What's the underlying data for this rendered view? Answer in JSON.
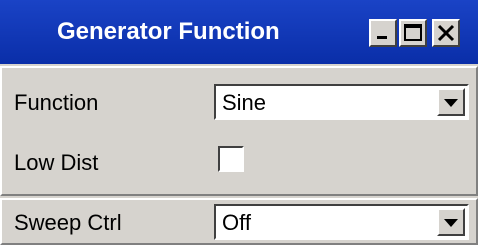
{
  "window": {
    "title": "Generator Function",
    "controls": [
      "minimize-icon",
      "maximize-icon",
      "close-icon"
    ]
  },
  "function_row": {
    "label": "Function",
    "value": "Sine"
  },
  "low_dist_row": {
    "label": "Low Dist",
    "checked": false
  },
  "sweep_row": {
    "label": "Sweep Ctrl",
    "value": "Off"
  },
  "colors": {
    "titlebar": "#0a2ea8",
    "title_text": "#ffffff",
    "panel": "#d6d3ce",
    "field": "#ffffff"
  }
}
